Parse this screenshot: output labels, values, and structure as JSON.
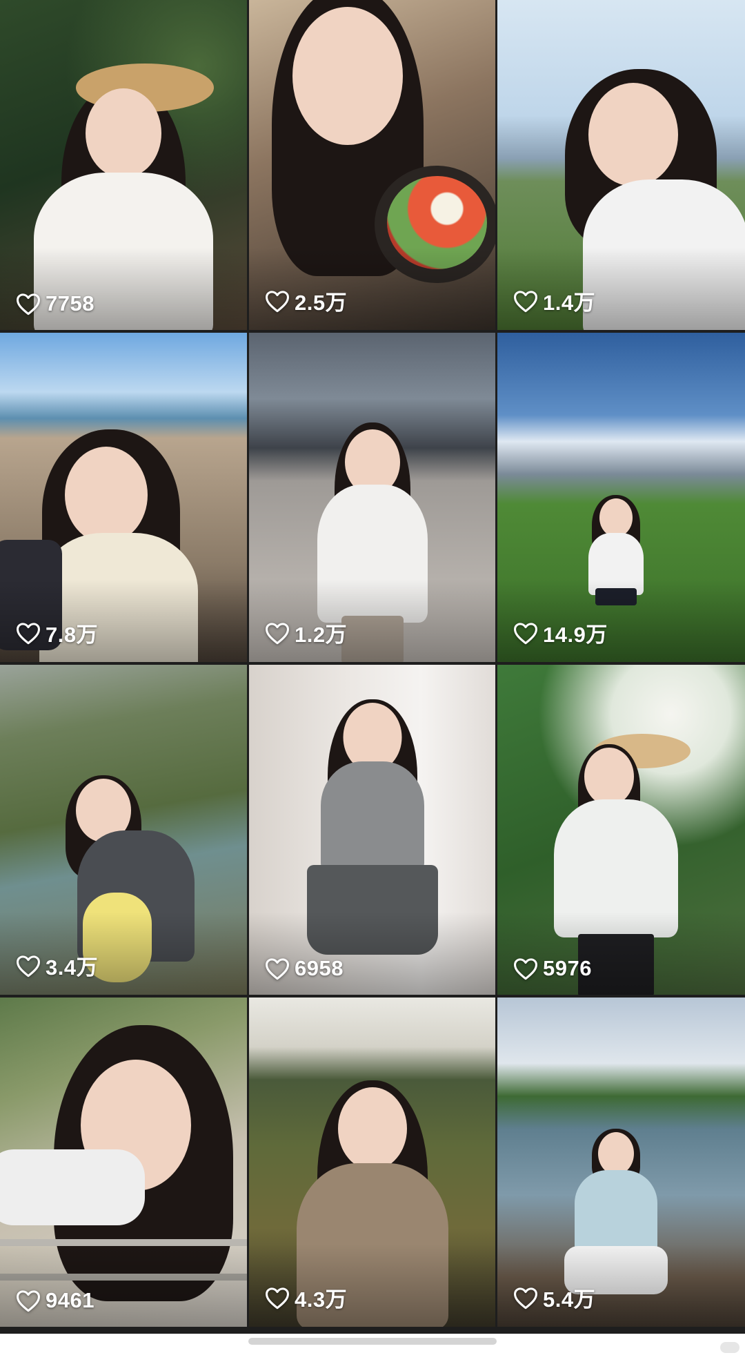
{
  "feed": {
    "posts": [
      {
        "likes": "7758",
        "scene": "garden-straw-hat"
      },
      {
        "likes": "2.5万",
        "scene": "selfie-bibimbap"
      },
      {
        "likes": "1.4万",
        "scene": "field-mountains"
      },
      {
        "likes": "7.8万",
        "scene": "beach-picnic"
      },
      {
        "likes": "1.2万",
        "scene": "city-street"
      },
      {
        "likes": "14.9万",
        "scene": "green-lawn-sky"
      },
      {
        "likes": "3.4万",
        "scene": "hillside-river"
      },
      {
        "likes": "6958",
        "scene": "indoor-hallway"
      },
      {
        "likes": "5976",
        "scene": "tropical-garden"
      },
      {
        "likes": "9461",
        "scene": "railing-closeup"
      },
      {
        "likes": "4.3万",
        "scene": "hill-sunset"
      },
      {
        "likes": "5.4万",
        "scene": "lakeside"
      }
    ]
  },
  "colors": {
    "background": "#1e1e1e",
    "like_text": "#ffffff",
    "bottom_bar": "#ffffff",
    "home_indicator": "#d4d4d4"
  },
  "icons": {
    "like": "heart-outline-icon"
  }
}
